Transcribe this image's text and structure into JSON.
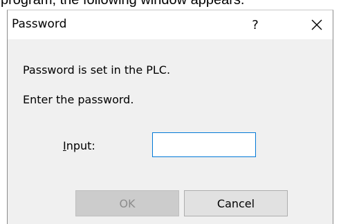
{
  "caption_fragment": "program, the following window appears.",
  "dialog": {
    "title": "Password",
    "help_glyph": "?",
    "close_icon": "close-icon",
    "message_line1": "Password is set in the PLC.",
    "message_line2": "Enter the password.",
    "input_label_accel": "I",
    "input_label_rest": "nput:",
    "input_value": "",
    "ok_label": "OK",
    "ok_enabled": false,
    "cancel_label": "Cancel"
  },
  "colors": {
    "dialog_background": "#f0f0f0",
    "titlebar_background": "#ffffff",
    "input_focus_border": "#0078d7",
    "disabled_button_background": "#cccccc",
    "disabled_button_text": "#8c8c8c"
  }
}
